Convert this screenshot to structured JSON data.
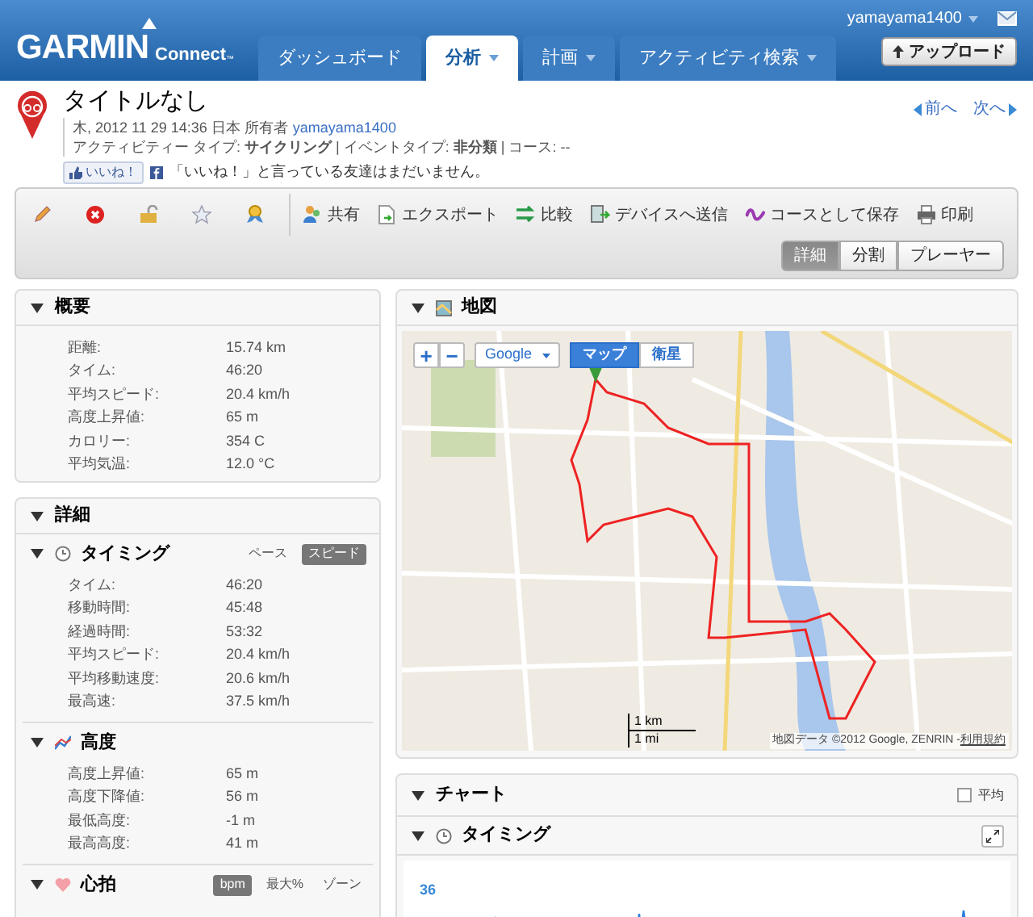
{
  "header": {
    "logo": "GARMIN",
    "logo_sub": "Connect",
    "logo_mark": "™",
    "user": "yamayama1400",
    "upload": "アップロード",
    "tabs": [
      {
        "label": "ダッシュボード",
        "selected": false,
        "dropdown": false
      },
      {
        "label": "分析",
        "selected": true,
        "dropdown": true
      },
      {
        "label": "計画",
        "selected": false,
        "dropdown": true
      },
      {
        "label": "アクティビティ検索",
        "selected": false,
        "dropdown": true
      }
    ]
  },
  "activity": {
    "title": "タイトルなし",
    "meta": "木, 2012 11 29 14:36 日本 所有者",
    "owner": "yamayama1400",
    "details": "アクティビティー タイプ: **サイクリング** | イベントタイプ: **非分類** | コース: --",
    "like_button": "いいね！",
    "like_text": "「いいね！」と言っている友達はまだいません。",
    "prev": "前へ",
    "next": "次へ"
  },
  "toolbar": {
    "actions": [
      "共有",
      "エクスポート",
      "比較",
      "デバイスへ送信",
      "コースとして保存",
      "印刷"
    ],
    "views": [
      {
        "label": "詳細",
        "selected": true
      },
      {
        "label": "分割",
        "selected": false
      },
      {
        "label": "プレーヤー",
        "selected": false
      }
    ]
  },
  "summary": {
    "title": "概要",
    "rows": [
      {
        "label": "距離:",
        "value": "15.74 km"
      },
      {
        "label": "タイム:",
        "value": "46:20"
      },
      {
        "label": "平均スピード:",
        "value": "20.4 km/h"
      },
      {
        "label": "高度上昇値:",
        "value": "65 m"
      },
      {
        "label": "カロリー:",
        "value": "354 C"
      },
      {
        "label": "平均気温:",
        "value": "12.0 °C"
      }
    ]
  },
  "details": {
    "title": "詳細",
    "sections": [
      {
        "kind": "timing",
        "title": "タイミング",
        "toggles": [
          {
            "label": "ペース",
            "selected": false
          },
          {
            "label": "スピード",
            "selected": true
          }
        ],
        "rows": [
          {
            "label": "タイム:",
            "value": "46:20"
          },
          {
            "label": "移動時間:",
            "value": "45:48"
          },
          {
            "label": "経過時間:",
            "value": "53:32"
          },
          {
            "label": "平均スピード:",
            "value": "20.4 km/h"
          },
          {
            "label": "平均移動速度:",
            "value": "20.6 km/h"
          },
          {
            "label": "最高速:",
            "value": "37.5 km/h"
          }
        ]
      },
      {
        "kind": "elevation",
        "title": "高度",
        "rows": [
          {
            "label": "高度上昇値:",
            "value": "65 m"
          },
          {
            "label": "高度下降値:",
            "value": "56 m"
          },
          {
            "label": "最低高度:",
            "value": "-1 m"
          },
          {
            "label": "最高高度:",
            "value": "41 m"
          }
        ]
      },
      {
        "kind": "heart",
        "title": "心拍",
        "toggles": [
          {
            "label": "bpm",
            "selected": true
          },
          {
            "label": "最大%",
            "selected": false
          },
          {
            "label": "ゾーン",
            "selected": false
          }
        ]
      }
    ]
  },
  "map": {
    "title": "地図",
    "zoom_in": "+",
    "zoom_out": "−",
    "provider": "Google",
    "types": [
      {
        "label": "マップ",
        "selected": true
      },
      {
        "label": "衛星",
        "selected": false
      }
    ],
    "scale_km": "1 km",
    "scale_mi": "1 mi",
    "attribution": "地図データ ©2012 Google, ZENRIN - ",
    "terms": "利用規約"
  },
  "chart": {
    "title": "チャート",
    "average": {
      "label": "平均",
      "checked": false
    },
    "section": "タイミング",
    "y_label": "36"
  }
}
